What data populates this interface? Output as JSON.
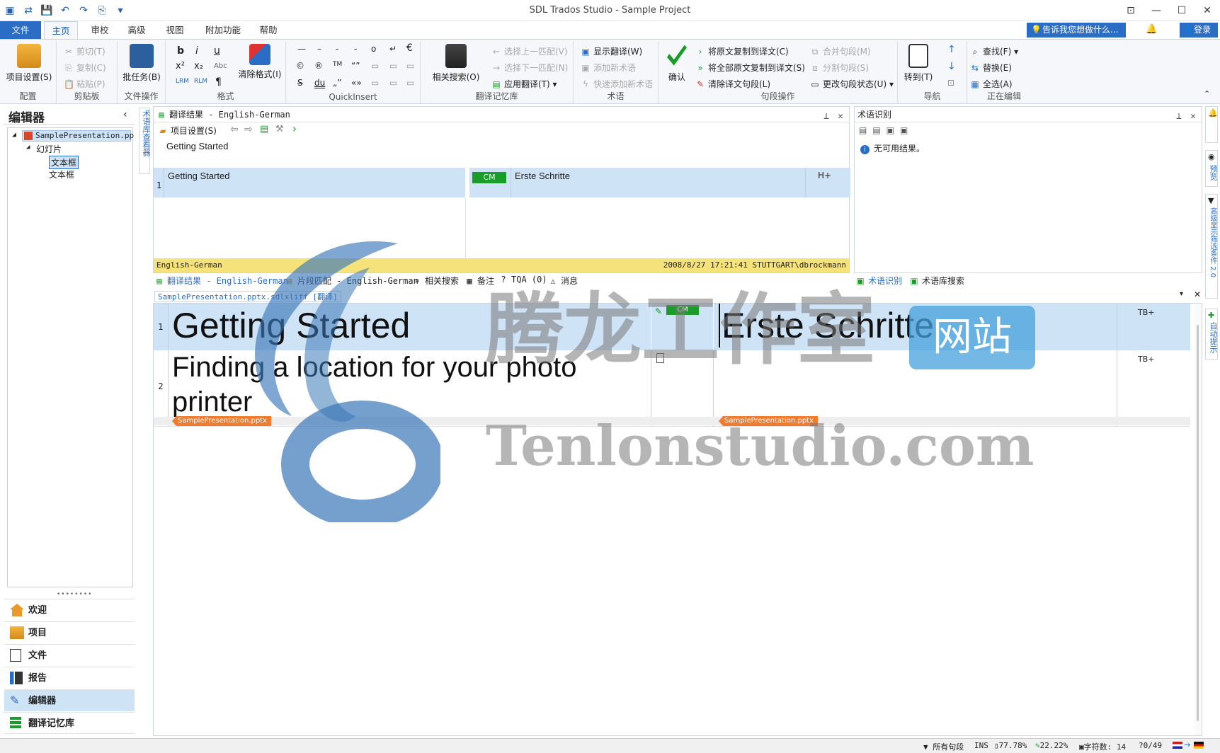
{
  "app": {
    "title": "SDL Trados Studio - Sample Project"
  },
  "tabs": [
    "文件",
    "主页",
    "审校",
    "高级",
    "视图",
    "附加功能",
    "帮助"
  ],
  "header": {
    "tell_me": "告诉我您想做什么...",
    "login": "登录"
  },
  "ribbon": {
    "project_settings": "项目设置(S)",
    "group_config": "配置",
    "cut": "剪切(T)",
    "copy": "复制(C)",
    "paste": "粘贴(P)",
    "group_clipboard": "剪贴板",
    "batch_tasks": "批任务(B)",
    "group_file_ops": "文件操作",
    "clear_format": "清除格式(I)",
    "group_format": "格式",
    "group_quickinsert": "QuickInsert",
    "concordance": "相关搜索(O)",
    "prev_match": "选择上一匹配(V)",
    "next_match": "选择下一匹配(N)",
    "apply_translation": "应用翻译(T)",
    "group_tm": "翻译记忆库",
    "show_translation": "显示翻译(W)",
    "add_term": "添加新术语",
    "quick_add_term": "快速添加新术语",
    "group_term": "术语",
    "confirm": "确认",
    "copy_source": "将原文复制到译文(C)",
    "copy_all_source": "将全部原文复制到译文(S)",
    "clear_target": "清除译文句段(L)",
    "merge_segments": "合并句段(M)",
    "split_segment": "分割句段(S)",
    "change_status": "更改句段状态(U)",
    "group_segment": "句段操作",
    "goto": "转到(T)",
    "group_nav": "导航",
    "find": "查找(F)",
    "replace": "替换(E)",
    "select_all": "全选(A)",
    "group_edit": "正在编辑"
  },
  "left": {
    "title": "编辑器",
    "tree": [
      "SamplePresentation.pp",
      "幻灯片",
      "文本框",
      "文本框"
    ],
    "nav": [
      "欢迎",
      "项目",
      "文件",
      "报告",
      "编辑器",
      "翻译记忆库"
    ]
  },
  "vertical_labels": {
    "left": "术语库查看器",
    "right1": "预览",
    "right2": "高级显示筛选条件 2.0",
    "right3": "自动提示"
  },
  "trans_results": {
    "title": "翻译结果 - English-German",
    "settings": "项目设置(S)",
    "query": "Getting Started",
    "row_num": "1",
    "source": "Getting Started",
    "score": "CM",
    "target": "Erste Schritte",
    "flag": "H+",
    "lang": "English-German",
    "meta": "2008/8/27 17:21:41 STUTTGART\\dbrockmann"
  },
  "term_panel": {
    "title": "术语识别",
    "no_result": "无可用结果。",
    "tab1": "术语识别",
    "tab2": "术语库搜索"
  },
  "bottom_tabs": [
    "翻译结果 - English-German",
    "片段匹配 - English-German",
    "相关搜索",
    "备注",
    "TQA (0)",
    "消息"
  ],
  "editor": {
    "file_tab": "SamplePresentation.pptx.sdlxliff [翻译]",
    "segments": [
      {
        "num": "1",
        "source": "Getting Started",
        "status": "CM",
        "target": "Erste Schritte",
        "flag": "TB+"
      },
      {
        "num": "2",
        "source": "Finding a location for your photo printer",
        "status": "",
        "target": "",
        "flag": "TB+"
      }
    ],
    "src_tag": "SamplePresentation.pptx",
    "tgt_tag": "SamplePresentation.pptx"
  },
  "watermark": {
    "cn": "腾龙工作室",
    "badge": "网站",
    "en": "Tenlonstudio.com"
  },
  "status": {
    "filter": "所有句段",
    "ins": "INS",
    "pct1": "77.78%",
    "pct2": "22.22%",
    "chars": "字符数: 14",
    "prog": "0/49"
  },
  "colors": {
    "accent": "#2b6cc4",
    "selection": "#cfe3f7",
    "cm": "#1a9c2a",
    "tag": "#f07c30",
    "lang_bar": "#f5e27a"
  }
}
